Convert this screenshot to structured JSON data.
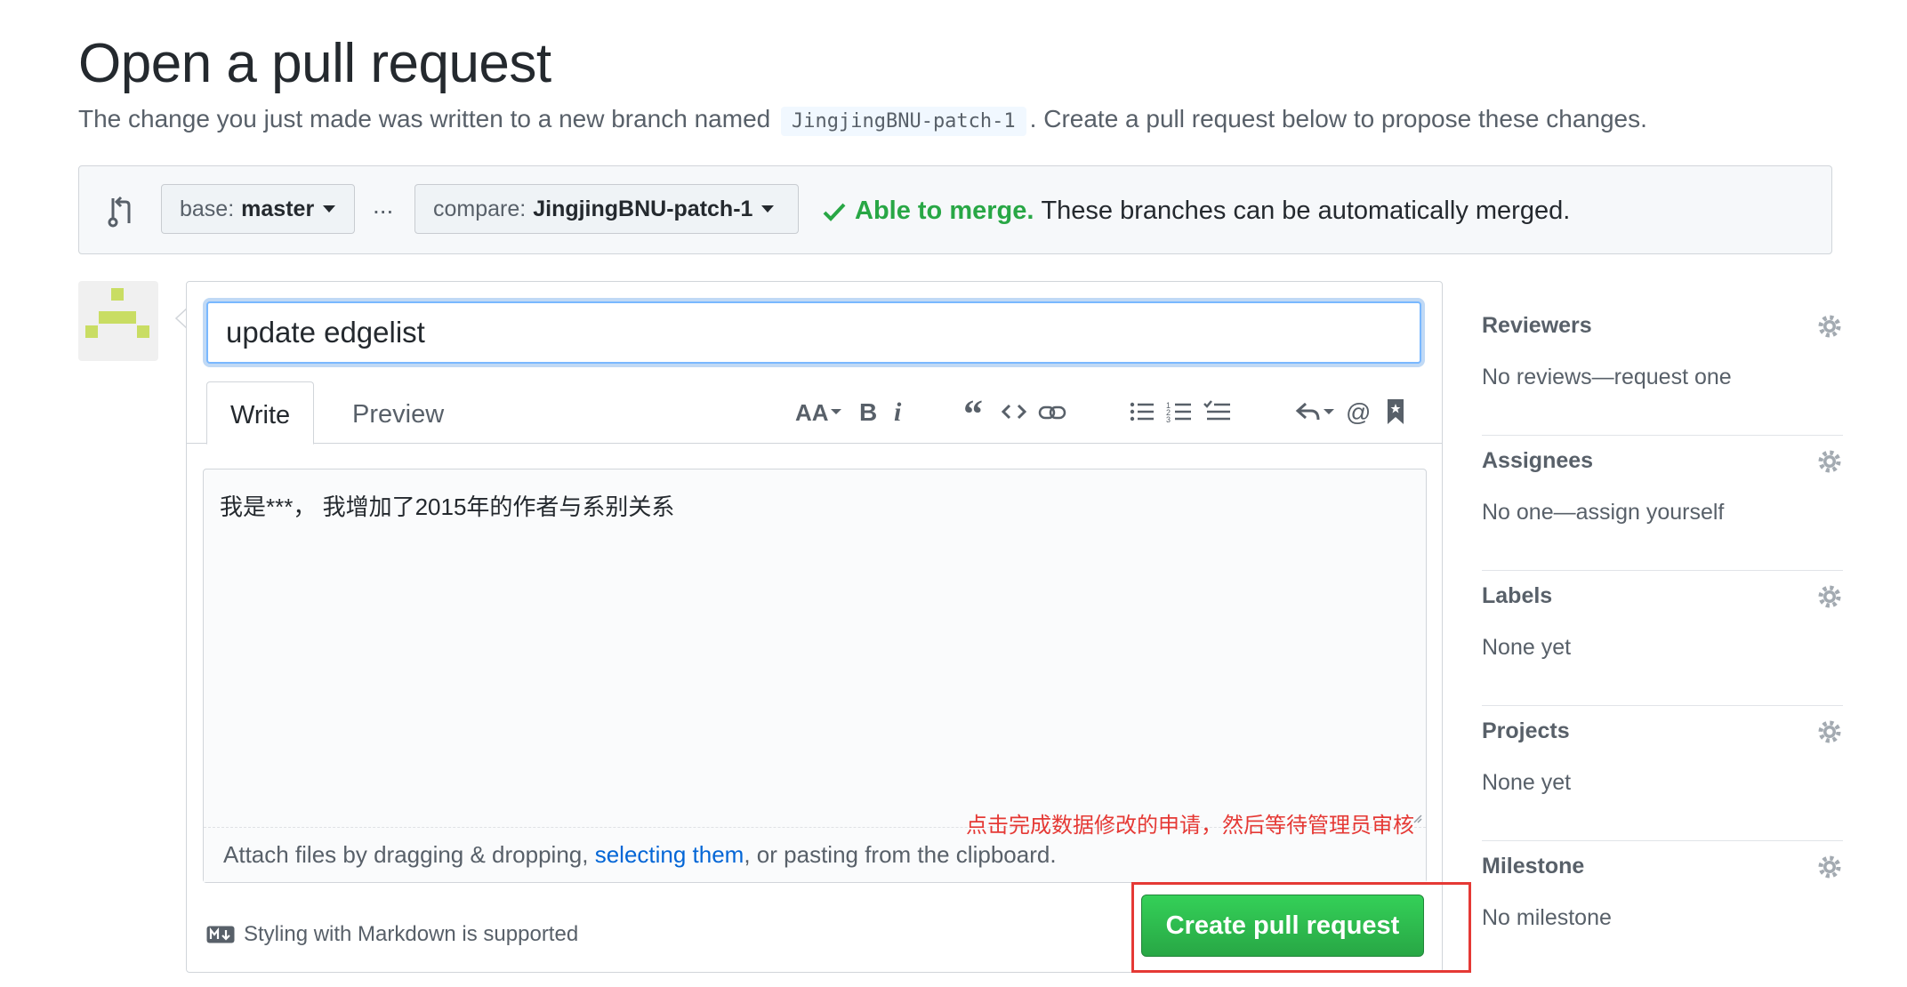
{
  "page": {
    "title": "Open a pull request",
    "subtitle_prefix": "The change you just made was written to a new branch named",
    "branch_name": "JingjingBNU-patch-1",
    "subtitle_suffix": ". Create a pull request below to propose these changes."
  },
  "range": {
    "base_label": "base:",
    "base_value": "master",
    "ellipsis": "...",
    "compare_label": "compare:",
    "compare_value": "JingjingBNU-patch-1",
    "merge_ok": "Able to merge.",
    "merge_msg": "These branches can be automatically merged.",
    "merge_color": "#28a745"
  },
  "composer": {
    "title_value": "update edgelist",
    "tabs": [
      {
        "label": "Write",
        "active": true
      },
      {
        "label": "Preview",
        "active": false
      }
    ],
    "toolbar": [
      "header-icon",
      "bold-icon",
      "italic-icon",
      "quote-icon",
      "code-icon",
      "link-icon",
      "bulleted-list-icon",
      "numbered-list-icon",
      "task-list-icon",
      "reply-icon",
      "mention-icon",
      "saved-reply-icon"
    ],
    "body_text": "我是***，   我增加了2015年的作者与系别关系",
    "attach_prefix": "Attach files by dragging & dropping, ",
    "attach_link": "selecting them",
    "attach_suffix": ", or pasting from the clipboard.",
    "markdown_note": "Styling with Markdown is supported",
    "submit_label": "Create pull request",
    "annotation": "点击完成数据修改的申请，然后等待管理员审核",
    "annotation_color": "#e53935"
  },
  "sidebar": {
    "sections": [
      {
        "heading": "Reviewers",
        "value": "No reviews—request one"
      },
      {
        "heading": "Assignees",
        "value": "No one—assign yourself"
      },
      {
        "heading": "Labels",
        "value": "None yet"
      },
      {
        "heading": "Projects",
        "value": "None yet"
      },
      {
        "heading": "Milestone",
        "value": "No milestone"
      }
    ]
  }
}
